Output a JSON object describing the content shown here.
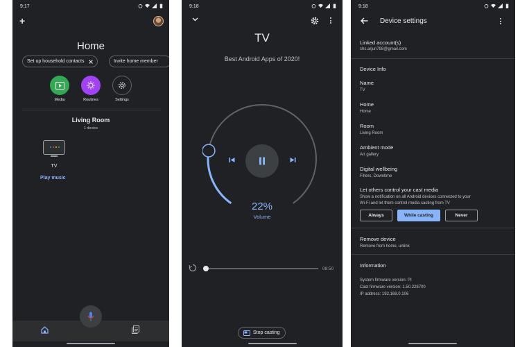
{
  "panel1": {
    "status": {
      "time": "9:17"
    },
    "title": "Home",
    "chips": [
      "Set up household contacts",
      "Invite home member"
    ],
    "actions": [
      {
        "label": "Media",
        "icon": "media-icon",
        "color": "#34a853"
      },
      {
        "label": "Routines",
        "icon": "routines-icon",
        "color": "#a142f4"
      },
      {
        "label": "Settings",
        "icon": "settings-icon",
        "color": "#202124"
      }
    ],
    "room": {
      "title": "Living Room",
      "count": "1 device"
    },
    "device": {
      "name": "TV",
      "action": "Play music"
    }
  },
  "panel2": {
    "status": {
      "time": "9:18"
    },
    "device_title": "TV",
    "media_title": "Best Android Apps of 2020!",
    "volume": {
      "percent_label": "22%",
      "label": "Volume",
      "level": 0.22
    },
    "duration": "08:50",
    "progress": 0.0,
    "stop_casting": "Stop casting"
  },
  "panel3": {
    "status": {
      "time": "9:18"
    },
    "title": "Device settings",
    "linked": {
      "label": "Linked account(s)",
      "value": "shs.arjun798@gmail.com"
    },
    "device_info_header": "Device Info",
    "items": [
      {
        "label": "Name",
        "value": "TV"
      },
      {
        "label": "Home",
        "value": "Home"
      },
      {
        "label": "Room",
        "value": "Living Room"
      },
      {
        "label": "Ambient mode",
        "value": "Art gallery"
      },
      {
        "label": "Digital wellbeing",
        "value": "Filters, Downtime"
      }
    ],
    "cast_control": {
      "label": "Let others control your cast media",
      "desc1": "Show a notification on all Android devices connected to your",
      "desc2": "Wi-Fi and let them control media casting from TV",
      "options": [
        "Always",
        "While casting",
        "Never"
      ],
      "selected": "While casting"
    },
    "remove": {
      "label": "Remove device",
      "value": "Remove from home, unlink"
    },
    "information": {
      "header": "Information",
      "lines": [
        "System firmware version: PI",
        "Cast firmware version: 1.50.228700",
        "IP address: 192.168.0.106"
      ]
    }
  },
  "colors": {
    "background": "#202124",
    "accent": "#8ab4f8",
    "divider": "#3c4043"
  }
}
